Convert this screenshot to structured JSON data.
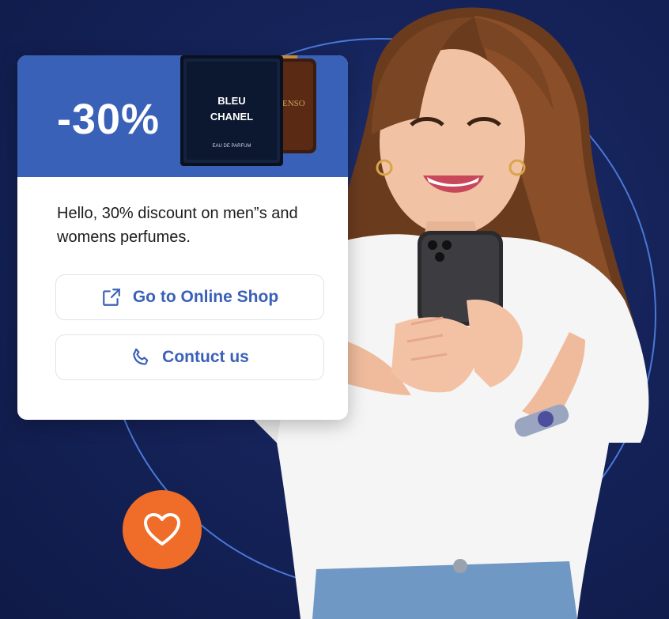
{
  "promo": {
    "discount_label": "-30%",
    "message": "Hello, 30% discount on men”s and womens perfumes.",
    "product_front_line1": "BLEU",
    "product_front_line2": "CHANEL",
    "product_front_sub": "EAU DE PARFUM",
    "product_back_text": "TENSO"
  },
  "actions": {
    "shop_label": "Go to Online Shop",
    "contact_label": "Contuct us",
    "shop_icon": "external-link-icon",
    "contact_icon": "phone-icon"
  },
  "badge": {
    "icon": "heart-icon"
  },
  "colors": {
    "background": "#15235a",
    "accent": "#3a61b8",
    "ring": "#4a78d6",
    "heart_badge": "#ef6d28"
  }
}
